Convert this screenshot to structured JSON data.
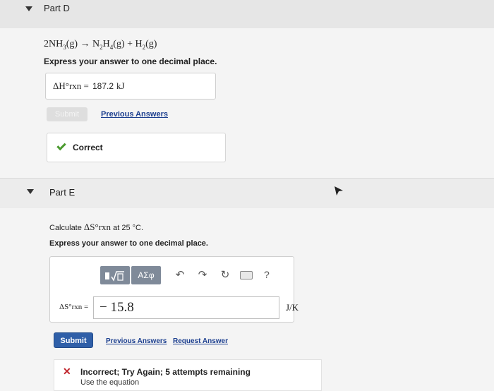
{
  "partD": {
    "title": "Part D",
    "reaction": {
      "r_coef": "2NH",
      "r_sub": "3",
      "r_state": "(g) → N",
      "p1_sub": "2",
      "p1_mid": "H",
      "p1_sub2": "4",
      "p1_state": "(g) + H",
      "p2_sub": "2",
      "p2_state": "(g)"
    },
    "instruction": "Express your answer to one decimal place.",
    "answer_label": "ΔH°rxn =",
    "answer_value": "187.2",
    "answer_unit": "kJ",
    "submit_label": "Submit",
    "previous_answers_label": "Previous Answers",
    "feedback_label": "Correct"
  },
  "partE": {
    "title": "Part E",
    "prompt_prefix": "Calculate",
    "prompt_symbol": "ΔS°rxn",
    "prompt_suffix": "at 25 °C.",
    "instruction": "Express your answer to one decimal place.",
    "toolbar": {
      "templates_icon": "sqrt-template-icon",
      "greek_label": "ΑΣφ",
      "undo_icon": "undo-icon",
      "redo_icon": "redo-icon",
      "reset_icon": "reset-icon",
      "keyboard_icon": "keyboard-icon",
      "help_label": "?"
    },
    "input_label": "ΔS°rxn =",
    "input_value": "− 15.8",
    "unit": "J/K",
    "submit_label": "Submit",
    "previous_answers_label": "Previous Answers",
    "request_answer_label": "Request Answer",
    "feedback_title": "Incorrect; Try Again; 5 attempts remaining",
    "feedback_detail": "Use the equation"
  },
  "colors": {
    "link": "#1c3f8f",
    "submit_blue": "#2f5fa8",
    "correct_green": "#4a9a2e",
    "incorrect_red": "#c0252c"
  }
}
